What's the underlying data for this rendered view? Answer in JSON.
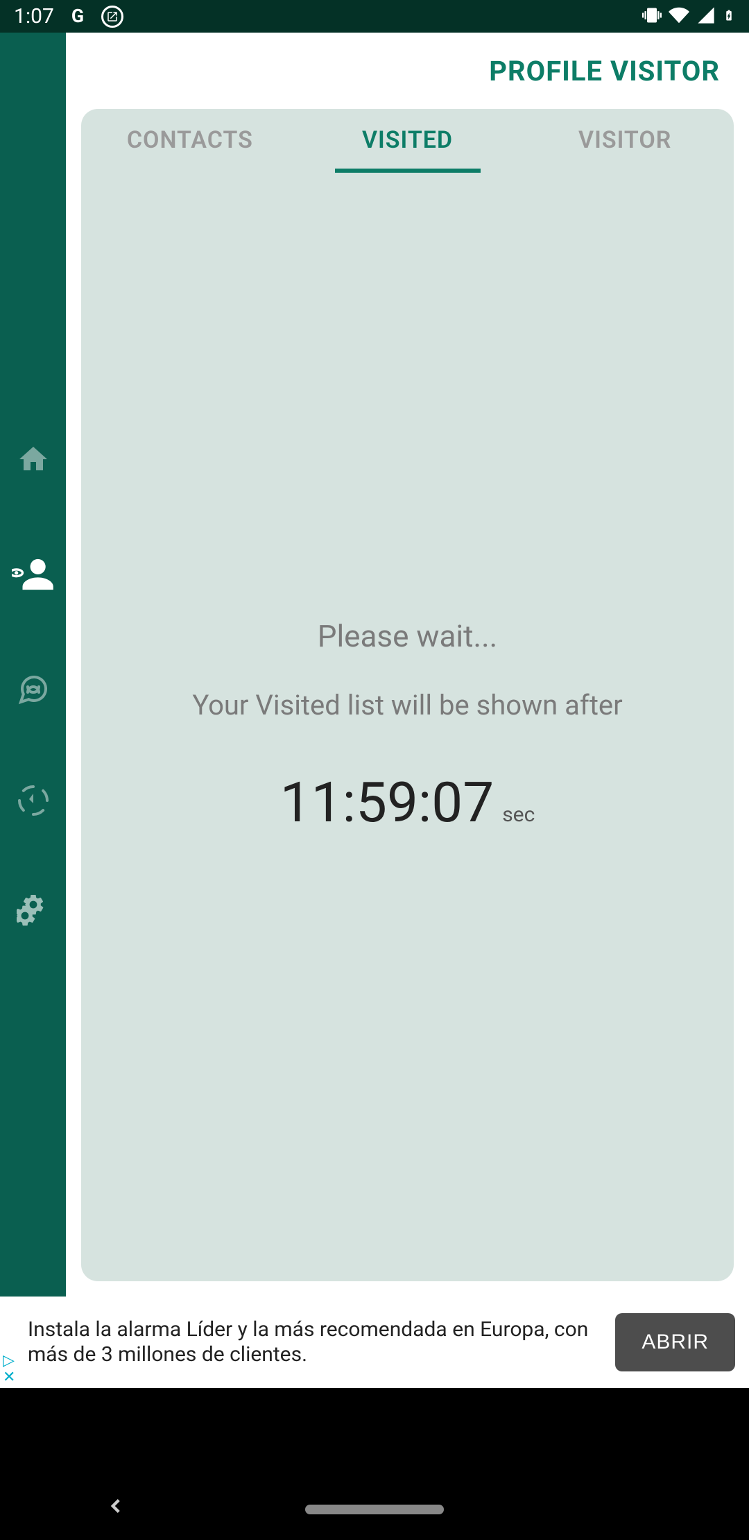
{
  "statusBar": {
    "time": "1:07"
  },
  "header": {
    "title": "PROFILE VISITOR"
  },
  "tabs": {
    "contacts": "CONTACTS",
    "visited": "VISITED",
    "visitor": "VISITOR"
  },
  "content": {
    "waitText": "Please wait...",
    "subtext": "Your Visited list will be shown after",
    "timer": "11:59:07",
    "timerUnit": "sec"
  },
  "ad": {
    "text": "Instala la alarma Líder y la más recomendada en Europa, con más de 3 millones de clientes.",
    "button": "ABRIR"
  }
}
